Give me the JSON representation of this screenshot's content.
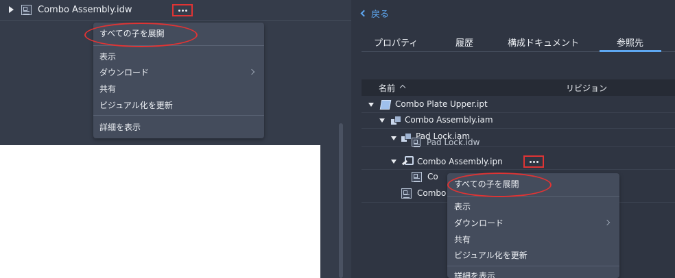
{
  "left": {
    "file_name": "Combo Assembly.idw",
    "menu": {
      "items": [
        {
          "label": "すべての子を展開",
          "has_submenu": false
        },
        {
          "label": "表示",
          "has_submenu": false
        },
        {
          "label": "ダウンロード",
          "has_submenu": true
        },
        {
          "label": "共有",
          "has_submenu": false
        },
        {
          "label": "ビジュアル化を更新",
          "has_submenu": false
        },
        {
          "label": "詳細を表示",
          "has_submenu": false
        }
      ]
    }
  },
  "right": {
    "back_label": "戻る",
    "tabs": [
      {
        "label": "プロパティ",
        "active": false
      },
      {
        "label": "履歴",
        "active": false
      },
      {
        "label": "構成ドキュメント",
        "active": false
      },
      {
        "label": "参照先",
        "active": true
      }
    ],
    "table": {
      "col_name": "名前",
      "col_revision": "リビジョン"
    },
    "rows": [
      {
        "label": "Combo Plate Upper.ipt"
      },
      {
        "label": "Combo Assembly.iam"
      },
      {
        "label": "Pad Lock.iam"
      },
      {
        "label": "Pad Lock.idw"
      },
      {
        "label": "Combo Assembly.ipn"
      },
      {
        "label": "Co"
      },
      {
        "label": "Combo"
      }
    ],
    "menu": {
      "items": [
        {
          "label": "すべての子を展開",
          "has_submenu": false
        },
        {
          "label": "表示",
          "has_submenu": false
        },
        {
          "label": "ダウンロード",
          "has_submenu": true
        },
        {
          "label": "共有",
          "has_submenu": false
        },
        {
          "label": "ビジュアル化を更新",
          "has_submenu": false
        },
        {
          "label": "詳細を表示",
          "has_submenu": false
        }
      ]
    }
  },
  "colors": {
    "highlight": "#e03434",
    "accent": "#5ea8f2",
    "panel_bg": "#353c4a",
    "menu_bg": "#444c5c"
  }
}
